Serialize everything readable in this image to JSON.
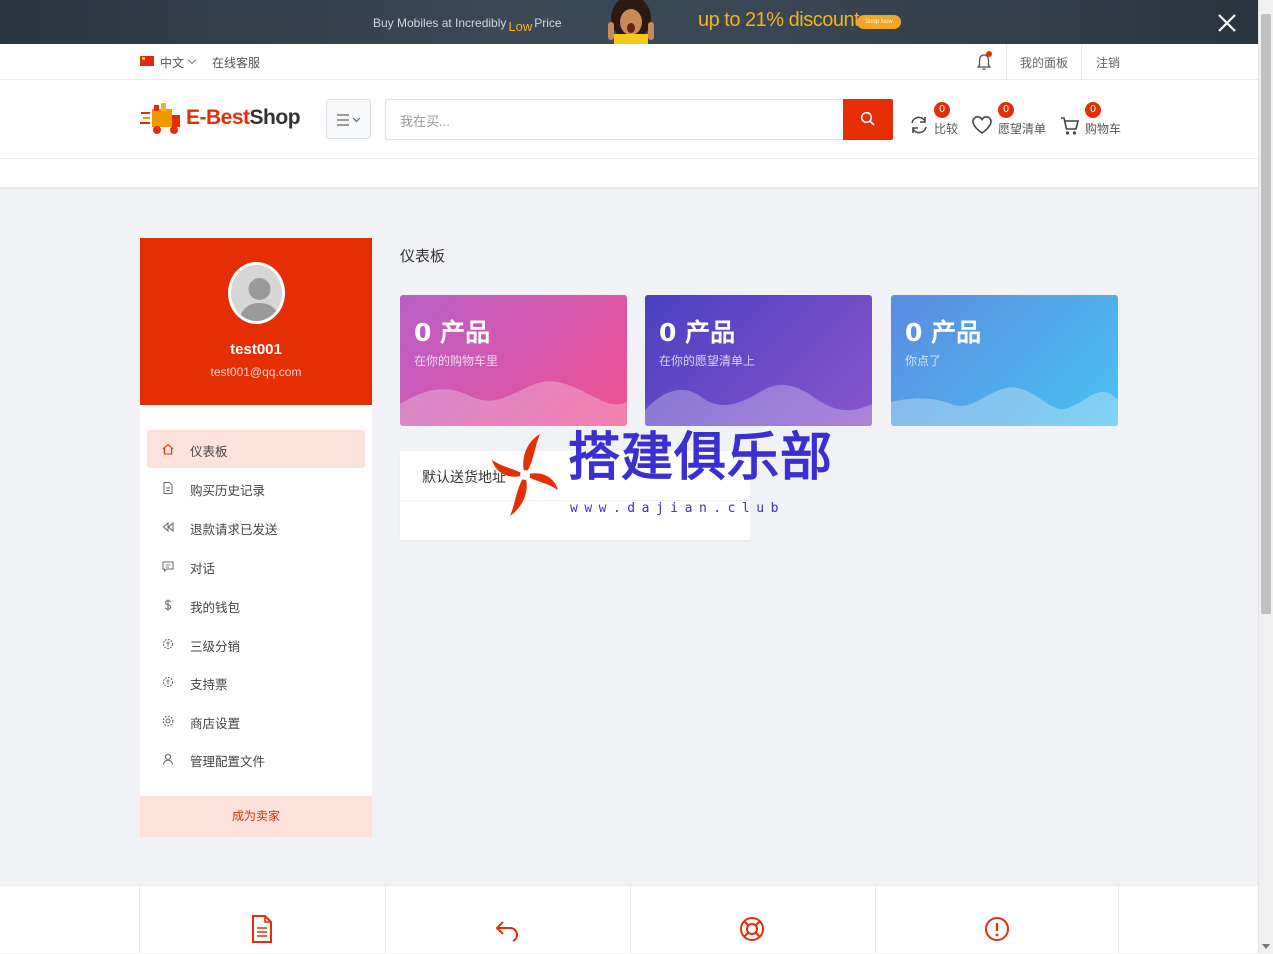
{
  "promo": {
    "left_text": "Buy Mobiles at Incredibly",
    "low_text": "Low",
    "price_text": "Price",
    "discount_text": "up to 21% discount",
    "shop_now": "Shop Now"
  },
  "topbar": {
    "language": "中文",
    "service": "在线客服",
    "dashboard_link": "我的面板",
    "logout": "注销"
  },
  "header": {
    "logo_e": "E-Best",
    "logo_shop": "Shop",
    "search_placeholder": "我在买...",
    "compare": {
      "count": "0",
      "label": "比较"
    },
    "wishlist": {
      "count": "0",
      "label": "愿望清单"
    },
    "cart": {
      "count": "0",
      "label": "购物车"
    }
  },
  "profile": {
    "username": "test001",
    "email": "test001@qq.com"
  },
  "menu": {
    "items": [
      {
        "label": "仪表板",
        "icon": "home-icon"
      },
      {
        "label": "购买历史记录",
        "icon": "file-icon"
      },
      {
        "label": "退款请求已发送",
        "icon": "rewind-icon"
      },
      {
        "label": "对话",
        "icon": "chat-icon"
      },
      {
        "label": "我的钱包",
        "icon": "dollar-icon"
      },
      {
        "label": "三级分销",
        "icon": "badge-icon"
      },
      {
        "label": "支持票",
        "icon": "badge-icon"
      },
      {
        "label": "商店设置",
        "icon": "gear-icon"
      },
      {
        "label": "管理配置文件",
        "icon": "user-icon"
      }
    ],
    "seller_button": "成为卖家"
  },
  "main": {
    "title": "仪表板",
    "cards": [
      {
        "count": "0 产品",
        "subtitle": "在你的购物车里",
        "color_from": "#b85fc8",
        "color_to": "#f0508f"
      },
      {
        "count": "0 产品",
        "subtitle": "在你的愿望清单上",
        "color_from": "#4a3fc1",
        "color_to": "#8a56cc"
      },
      {
        "count": "0 产品",
        "subtitle": "你点了",
        "color_from": "#5a8be0",
        "color_to": "#49c3f0"
      }
    ],
    "address_title": "默认送货地址"
  },
  "watermark": {
    "text": "搭建俱乐部",
    "url": "www.dajian.club"
  },
  "colors": {
    "accent": "#e62e04",
    "accent_light": "#fde2dc"
  }
}
